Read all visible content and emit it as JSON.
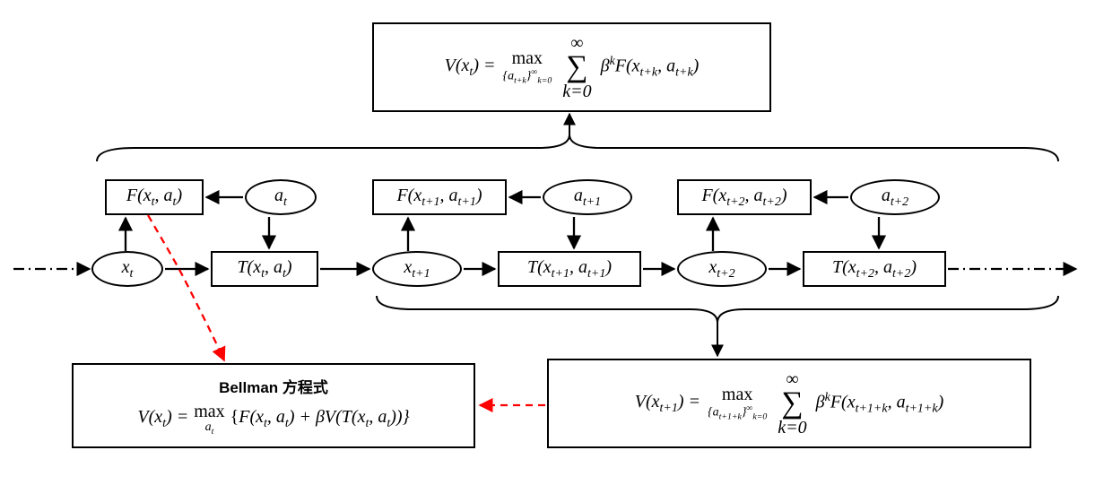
{
  "top_eq": {
    "lhs": "V(x",
    "lhs_sub": "t",
    "lhs_close": ") =",
    "max": "max",
    "max_sub_pre": "{a",
    "max_sub_tk": "t+k",
    "max_sub_post": "}",
    "max_sub_klow": "k=0",
    "max_sub_inf": "∞",
    "sum_top": "∞",
    "sum_bot": "k=0",
    "rhs_beta": "β",
    "rhs_k": "k",
    "rhs_F": "F(x",
    "rhs_F_sub1": "t+k",
    "rhs_mid": ", a",
    "rhs_F_sub2": "t+k",
    "rhs_close": ")"
  },
  "row": {
    "F0": {
      "pre": "F(x",
      "s1": "t",
      "mid": ", a",
      "s2": "t",
      "post": ")"
    },
    "a0": {
      "pre": "a",
      "s": "t"
    },
    "x0": {
      "pre": "x",
      "s": "t"
    },
    "T0": {
      "pre": "T(x",
      "s1": "t",
      "mid": ", a",
      "s2": "t",
      "post": ")"
    },
    "F1": {
      "pre": "F(x",
      "s1": "t+1",
      "mid": ", a",
      "s2": "t+1",
      "post": ")"
    },
    "a1": {
      "pre": "a",
      "s": "t+1"
    },
    "x1": {
      "pre": "x",
      "s": "t+1"
    },
    "T1": {
      "pre": "T(x",
      "s1": "t+1",
      "mid": ", a",
      "s2": "t+1",
      "post": ")"
    },
    "F2": {
      "pre": "F(x",
      "s1": "t+2",
      "mid": ", a",
      "s2": "t+2",
      "post": ")"
    },
    "a2": {
      "pre": "a",
      "s": "t+2"
    },
    "x2": {
      "pre": "x",
      "s": "t+2"
    },
    "T2": {
      "pre": "T(x",
      "s1": "t+2",
      "mid": ", a",
      "s2": "t+2",
      "post": ")"
    }
  },
  "bellman": {
    "title": "Bellman  方程式",
    "lhs": "V(x",
    "lhs_sub": "t",
    "lhs_close": ") =",
    "max": "max",
    "max_sub": "a",
    "max_sub_t": "t",
    "open": "{",
    "F": "F(x",
    "F_s1": "t",
    "F_mid": ", a",
    "F_s2": "t",
    "F_close": ") + βV(T(x",
    "T_s1": "t",
    "T_mid": ", a",
    "T_s2": "t",
    "close": "))}"
  },
  "bottom_eq": {
    "lhs": "V(x",
    "lhs_sub": "t+1",
    "lhs_close": ") =",
    "max": "max",
    "max_sub_pre": "{a",
    "max_sub_tk": "t+1+k",
    "max_sub_post": "}",
    "max_sub_klow": "k=0",
    "max_sub_inf": "∞",
    "sum_top": "∞",
    "sum_bot": "k=0",
    "rhs_beta": "β",
    "rhs_k": "k",
    "rhs_F": "F(x",
    "rhs_F_sub1": "t+1+k",
    "rhs_mid": ", a",
    "rhs_F_sub2": "t+1+k",
    "rhs_close": ")"
  }
}
